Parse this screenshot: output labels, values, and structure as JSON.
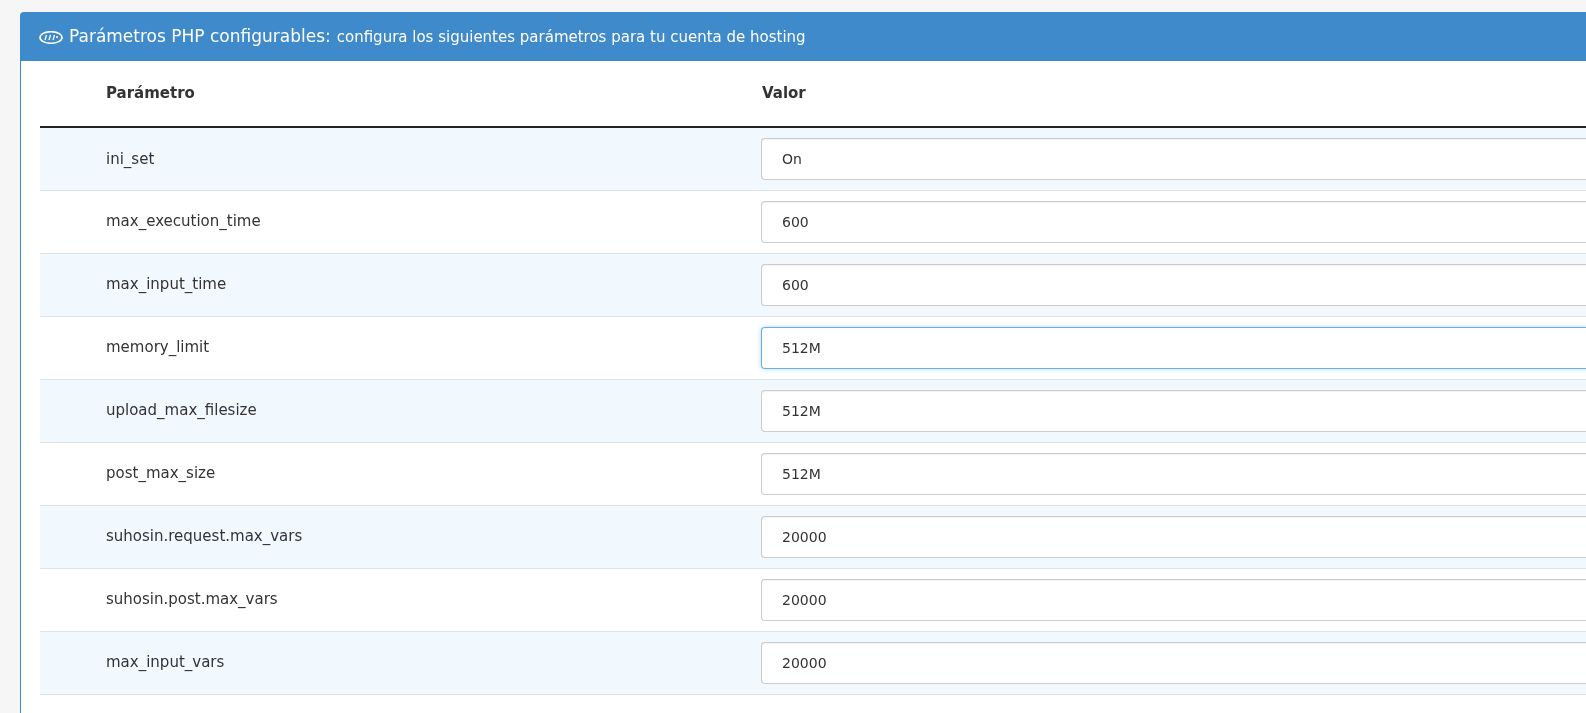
{
  "panel": {
    "title": "Parámetros PHP configurables:",
    "subtitle": "configura los siguientes parámetros para tu cuenta de hosting"
  },
  "table": {
    "columns": [
      "Parámetro",
      "Valor"
    ],
    "rows": [
      {
        "name": "ini_set",
        "value": "On",
        "focused": false
      },
      {
        "name": "max_execution_time",
        "value": "600",
        "focused": false
      },
      {
        "name": "max_input_time",
        "value": "600",
        "focused": false
      },
      {
        "name": "memory_limit",
        "value": "512M",
        "focused": true
      },
      {
        "name": "upload_max_filesize",
        "value": "512M",
        "focused": false
      },
      {
        "name": "post_max_size",
        "value": "512M",
        "focused": false
      },
      {
        "name": "suhosin.request.max_vars",
        "value": "20000",
        "focused": false
      },
      {
        "name": "suhosin.post.max_vars",
        "value": "20000",
        "focused": false
      },
      {
        "name": "max_input_vars",
        "value": "20000",
        "focused": false
      }
    ]
  }
}
